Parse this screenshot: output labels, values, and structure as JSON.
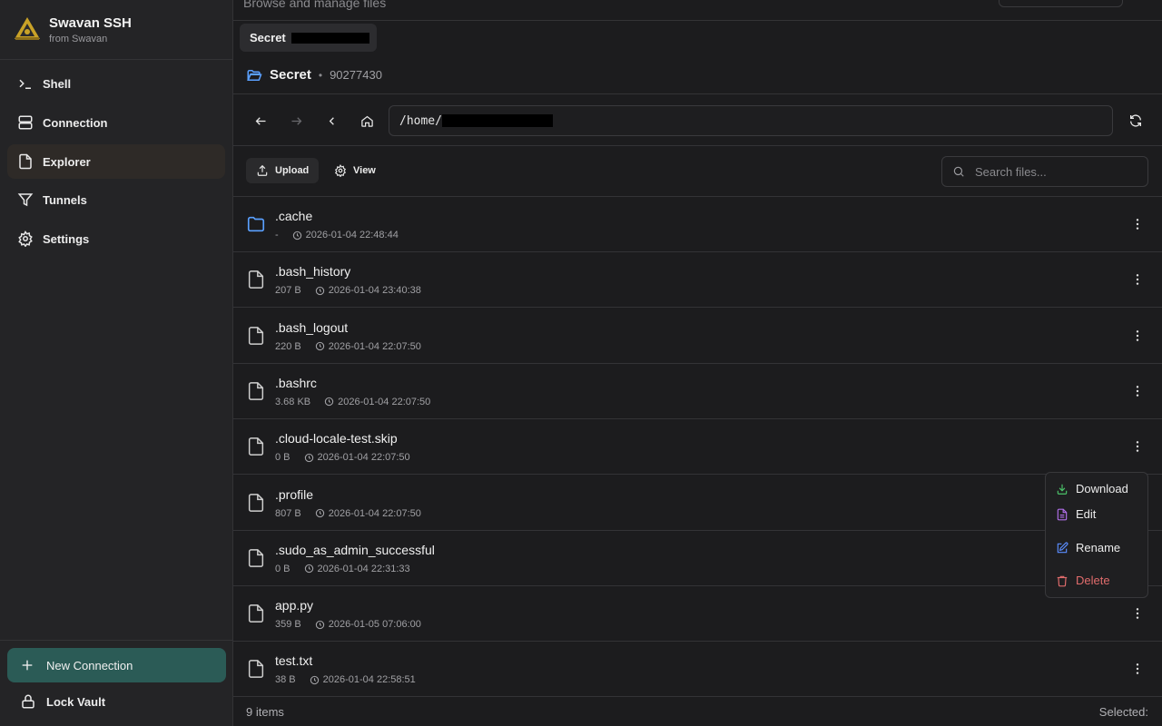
{
  "app": {
    "title": "Swavan SSH",
    "subtitle": "from Swavan"
  },
  "nav": {
    "items": [
      {
        "label": "Shell",
        "icon": "terminal-icon"
      },
      {
        "label": "Connection",
        "icon": "server-icon"
      },
      {
        "label": "Explorer",
        "icon": "file-icon",
        "active": true
      },
      {
        "label": "Tunnels",
        "icon": "filter-icon"
      },
      {
        "label": "Settings",
        "icon": "gear-icon"
      }
    ],
    "new_connection": "New Connection",
    "lock_vault": "Lock Vault"
  },
  "header": {
    "subtitle": "Browse and manage files"
  },
  "tab": {
    "label": "Secret"
  },
  "session": {
    "name": "Secret",
    "separator": "•",
    "id": "90277430"
  },
  "path": {
    "value": "/home/"
  },
  "toolbar": {
    "upload": "Upload",
    "view": "View",
    "search_placeholder": "Search files..."
  },
  "files": [
    {
      "name": ".cache",
      "size": "-",
      "modified": "2026-01-04 22:48:44",
      "type": "folder"
    },
    {
      "name": ".bash_history",
      "size": "207 B",
      "modified": "2026-01-04 23:40:38",
      "type": "file"
    },
    {
      "name": ".bash_logout",
      "size": "220 B",
      "modified": "2026-01-04 22:07:50",
      "type": "file"
    },
    {
      "name": ".bashrc",
      "size": "3.68 KB",
      "modified": "2026-01-04 22:07:50",
      "type": "file"
    },
    {
      "name": ".cloud-locale-test.skip",
      "size": "0 B",
      "modified": "2026-01-04 22:07:50",
      "type": "file"
    },
    {
      "name": ".profile",
      "size": "807 B",
      "modified": "2026-01-04 22:07:50",
      "type": "file"
    },
    {
      "name": ".sudo_as_admin_successful",
      "size": "0 B",
      "modified": "2026-01-04 22:31:33",
      "type": "file"
    },
    {
      "name": "app.py",
      "size": "359 B",
      "modified": "2026-01-05 07:06:00",
      "type": "file"
    },
    {
      "name": "test.txt",
      "size": "38 B",
      "modified": "2026-01-04 22:58:51",
      "type": "file"
    }
  ],
  "footer": {
    "count": "9 items",
    "selected": "Selected:"
  },
  "context_menu": {
    "download": "Download",
    "edit": "Edit",
    "rename": "Rename",
    "delete": "Delete"
  },
  "colors": {
    "accent": "#2b5b56",
    "folder": "#5aa0ff",
    "download": "#4cc36a",
    "edit": "#b06ee8",
    "rename": "#5a8dff",
    "delete": "#e06c6c"
  }
}
